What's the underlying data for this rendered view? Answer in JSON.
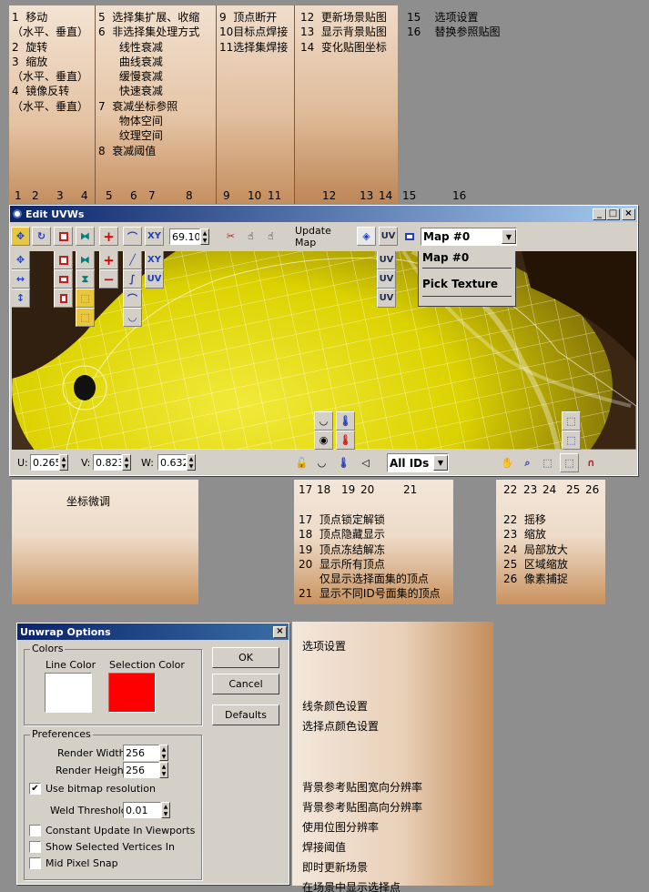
{
  "top_notes": {
    "col1": "1  移动\n（水平、垂直）\n2  旋转\n3  缩放\n（水平、垂直）\n4  镜像反转\n（水平、垂直）",
    "col2": "5  选择集扩展、收缩\n6  非选择集处理方式\n      线性衰减\n      曲线衰减\n      缓慢衰减\n      快速衰减\n7  衰减坐标参照\n      物体空间\n      纹理空间\n8  衰减阈值",
    "col3": "9  顶点断开\n10目标点焊接\n11选择集焊接",
    "col4": "12  更新场景贴图\n13  显示背景贴图\n14  变化贴图坐标",
    "col5": "15    选项设置\n16    替换参照贴图"
  },
  "top_numbers": [
    "1",
    "2",
    "3",
    "4",
    "5",
    "6",
    "7",
    "8",
    "9",
    "10",
    "11",
    "12",
    "13",
    "14",
    "15",
    "16"
  ],
  "bottom_numbers": [
    "17",
    "18",
    "19",
    "20",
    "21",
    "22",
    "23",
    "24",
    "25",
    "26"
  ],
  "edit_uvws": {
    "title": "Edit UVWs",
    "minimize": "_",
    "maximize": "□",
    "close": "×",
    "falloff_value": "69.10",
    "update_map_label": "Update Map",
    "map_select_value": "Map #0",
    "map_options": [
      "Map #0",
      "Pick Texture"
    ],
    "xy_label": "XY",
    "uv_label": "UV",
    "u_label": "U:",
    "u_value": "0.265",
    "v_label": "V:",
    "v_value": "0.823",
    "w_label": "W:",
    "w_value": "0.632",
    "ids_value": "All IDs"
  },
  "bottom_notes": {
    "coord": "坐标微调",
    "mid": "17  顶点锁定解锁\n18  顶点隐藏显示\n19  顶点冻结解冻\n20  显示所有顶点\n      仅显示选择面集的顶点\n21  显示不同ID号面集的顶点",
    "right": "22  摇移\n23  缩放\n24  局部放大\n25  区域缩放\n26  像素捕捉"
  },
  "unwrap_options": {
    "title": "Unwrap Options",
    "colors_label": "Colors",
    "line_color_label": "Line Color",
    "selection_color_label": "Selection Color",
    "line_color": "#ffffff",
    "selection_color": "#ff0000",
    "ok": "OK",
    "cancel": "Cancel",
    "defaults": "Defaults",
    "preferences_label": "Preferences",
    "render_width_label": "Render Width:",
    "render_width": "256",
    "render_height_label": "Render Height:",
    "render_height": "256",
    "use_bitmap_label": "Use bitmap resolution",
    "use_bitmap_checked": true,
    "weld_label": "Weld Threshold:",
    "weld_value": "0.01",
    "constant_update_label": "Constant Update In Viewports",
    "show_selected_label": "Show Selected Vertices In",
    "mid_pixel_label": "Mid Pixel Snap"
  },
  "options_notes": "选项设置\n\n\n线条颜色设置\n选择点颜色设置\n\n\n背景参考贴图宽向分辨率\n背景参考贴图高向分辨率\n使用位图分辨率\n焊接阈值\n即时更新场景\n在场景中显示选择点\n捕捉像素中心点"
}
